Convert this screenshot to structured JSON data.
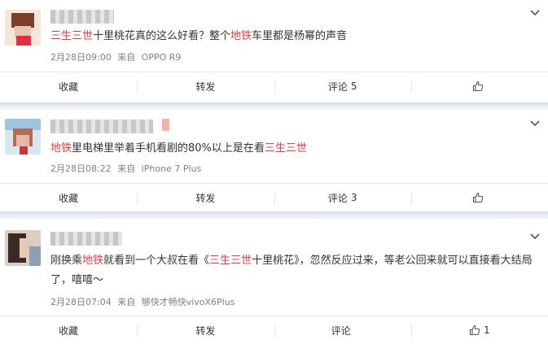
{
  "posts": [
    {
      "content": [
        {
          "text": "三生三世",
          "hl": true
        },
        {
          "text": "十里桃花真的这么好看？整个",
          "hl": false
        },
        {
          "text": "地铁",
          "hl": true
        },
        {
          "text": "车里都是杨幂的声音",
          "hl": false
        }
      ],
      "time": "2月28日09:00",
      "via": "来自",
      "device": "OPPO R9",
      "actions": {
        "favorite": "收藏",
        "repost": "转发",
        "comment": "评论",
        "comment_count": "5",
        "like_count": ""
      }
    },
    {
      "content": [
        {
          "text": "地铁",
          "hl": true
        },
        {
          "text": "里电梯里举着手机看剧的80%以上是在看",
          "hl": false
        },
        {
          "text": "三生三世",
          "hl": true
        }
      ],
      "time": "2月28日08:22",
      "via": "来自",
      "device": "iPhone 7 Plus",
      "actions": {
        "favorite": "收藏",
        "repost": "转发",
        "comment": "评论",
        "comment_count": "3",
        "like_count": ""
      }
    },
    {
      "content": [
        {
          "text": "刚换乘",
          "hl": false
        },
        {
          "text": "地铁",
          "hl": true
        },
        {
          "text": "就看到一个大叔在看《",
          "hl": false
        },
        {
          "text": "三生三世",
          "hl": true
        },
        {
          "text": "十里桃花》，忽然反应过来，等老公回来就可以直接看大结局了，嘻嘻～",
          "hl": false
        }
      ],
      "time": "2月28日07:04",
      "via": "来自",
      "device": "够快才畅快vivoX6Plus",
      "actions": {
        "favorite": "收藏",
        "repost": "转发",
        "comment": "评论",
        "comment_count": "",
        "like_count": "1"
      }
    }
  ],
  "colors": {
    "highlight": "#eb3b3b",
    "meta": "#808080",
    "text": "#333333"
  },
  "icons": {
    "menu": "chevron-down-icon",
    "like": "thumbs-up-icon"
  }
}
